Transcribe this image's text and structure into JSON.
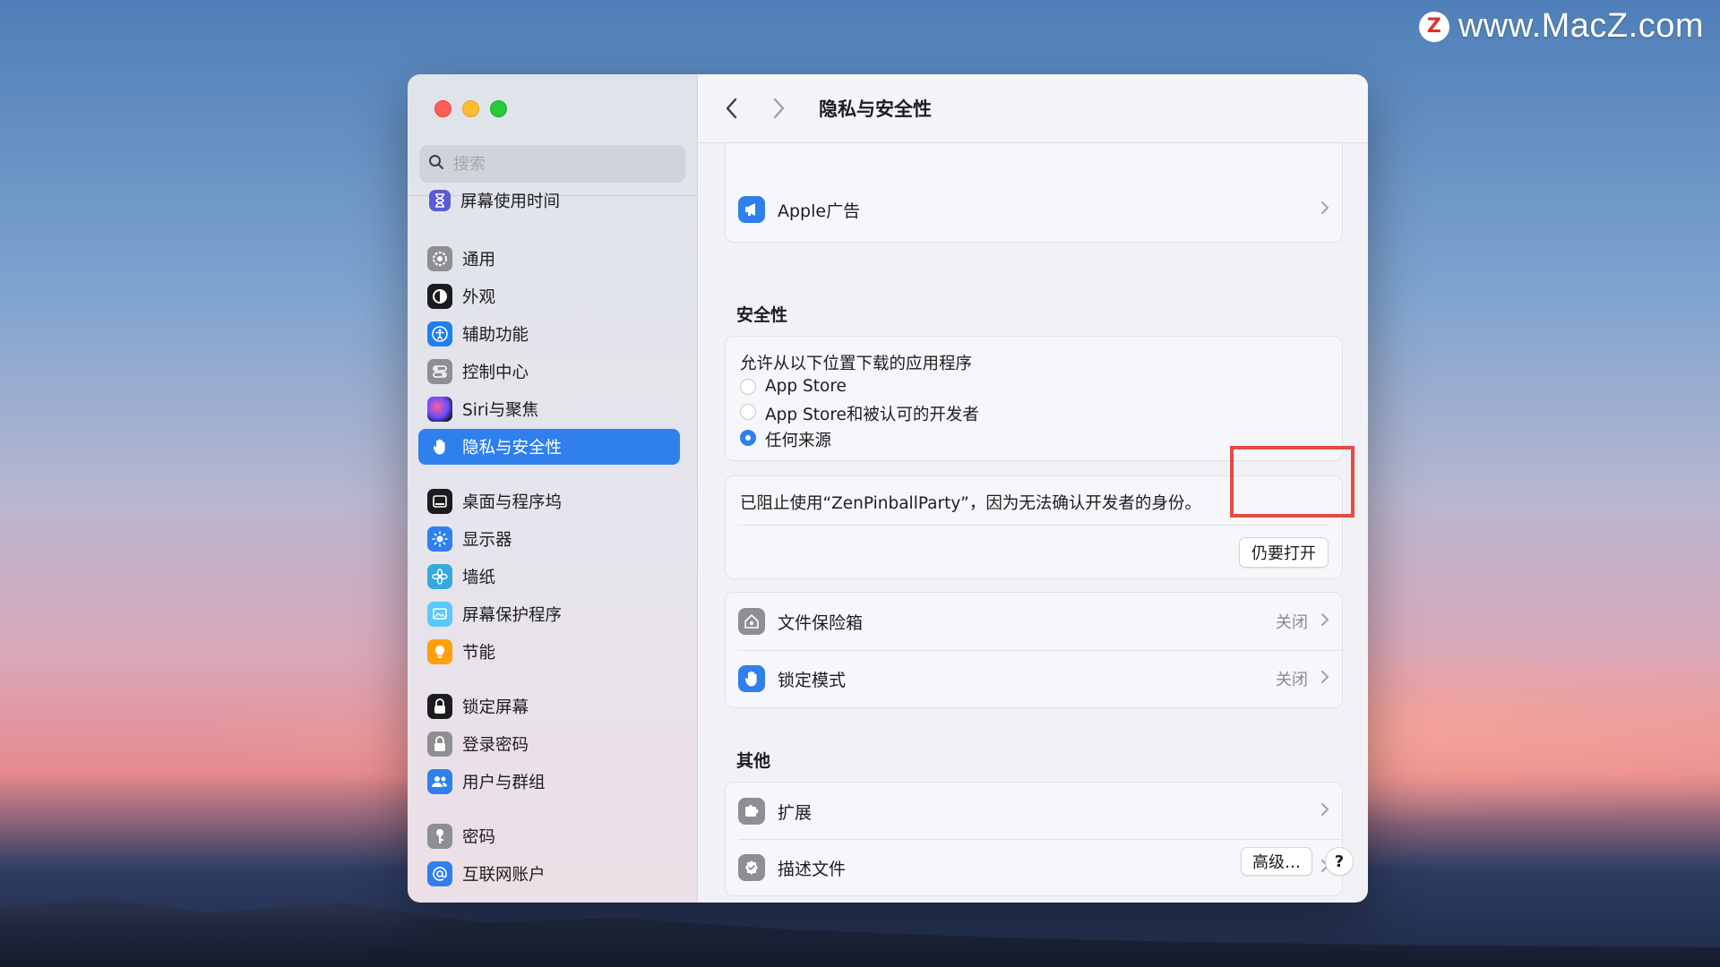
{
  "watermark": {
    "logo": "Z",
    "text": "www.MacZ.com"
  },
  "sidebar": {
    "search_placeholder": "搜索",
    "items": [
      {
        "label": "屏幕使用时间",
        "icon": "hourglass-icon",
        "color": "#5b5bd6"
      },
      {
        "label": "通用",
        "icon": "gear-icon",
        "color": "#8e8e93"
      },
      {
        "label": "外观",
        "icon": "appearance-icon",
        "color": "#1c1c1e"
      },
      {
        "label": "辅助功能",
        "icon": "accessibility-icon",
        "color": "#1f7ff0"
      },
      {
        "label": "控制中心",
        "icon": "control-center-icon",
        "color": "#8e8e93"
      },
      {
        "label": "Siri与聚焦",
        "icon": "siri-icon",
        "color": "#3a2b7a"
      },
      {
        "label": "隐私与安全性",
        "icon": "hand-icon",
        "color": "#2f80ed",
        "active": true
      },
      {
        "label": "桌面与程序坞",
        "icon": "dock-icon",
        "color": "#1c1c1e"
      },
      {
        "label": "显示器",
        "icon": "sun-icon",
        "color": "#2f80ed"
      },
      {
        "label": "墙纸",
        "icon": "flower-icon",
        "color": "#34aadc"
      },
      {
        "label": "屏幕保护程序",
        "icon": "screensaver-icon",
        "color": "#5ac8fa"
      },
      {
        "label": "节能",
        "icon": "lightbulb-icon",
        "color": "#ff9f0a"
      },
      {
        "label": "锁定屏幕",
        "icon": "lock-icon",
        "color": "#1c1c1e"
      },
      {
        "label": "登录密码",
        "icon": "lock-icon",
        "color": "#8e8e93"
      },
      {
        "label": "用户与群组",
        "icon": "users-icon",
        "color": "#2f80ed"
      },
      {
        "label": "密码",
        "icon": "key-icon",
        "color": "#8e8e93"
      },
      {
        "label": "互联网账户",
        "icon": "at-icon",
        "color": "#2f80ed"
      }
    ]
  },
  "toolbar": {
    "title": "隐私与安全性"
  },
  "main": {
    "apple_ads": {
      "label": "Apple广告",
      "icon": "megaphone-icon"
    },
    "security": {
      "title": "安全性",
      "allow_label": "允许从以下位置下载的应用程序",
      "options": [
        {
          "label": "App Store",
          "selected": false
        },
        {
          "label": "App Store和被认可的开发者",
          "selected": false
        },
        {
          "label": "任何来源",
          "selected": true
        }
      ],
      "blocked_message": "已阻止使用“ZenPinballParty”，因为无法确认开发者的身份。",
      "open_anyway": "仍要打开"
    },
    "filevault": {
      "label": "文件保险箱",
      "value": "关闭",
      "icon": "house-icon"
    },
    "lockdown": {
      "label": "锁定模式",
      "value": "关闭",
      "icon": "hand-icon"
    },
    "others": {
      "title": "其他",
      "extensions": {
        "label": "扩展",
        "icon": "extension-icon"
      },
      "profiles": {
        "label": "描述文件",
        "icon": "checkmark-badge-icon"
      }
    },
    "advanced_button": "高级…",
    "help_button": "?"
  },
  "colors": {
    "accent": "#2f80ed",
    "highlight": "#e64a45"
  }
}
